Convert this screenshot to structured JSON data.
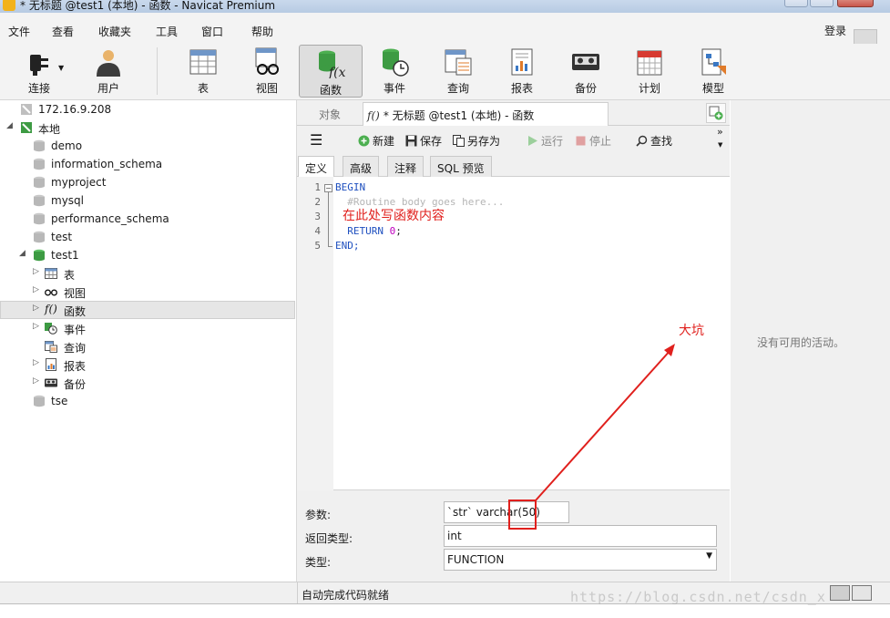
{
  "window": {
    "title": "* 无标题 @test1 (本地) - 函数 - Navicat Premium"
  },
  "menu": {
    "items": [
      "文件",
      "查看",
      "收藏夹",
      "工具",
      "窗口",
      "帮助"
    ],
    "login": "登录"
  },
  "toolbar": {
    "buttons": [
      {
        "label": "连接",
        "icon": "plug-icon"
      },
      {
        "label": "用户",
        "icon": "user-icon"
      },
      {
        "label": "表",
        "icon": "table-icon"
      },
      {
        "label": "视图",
        "icon": "view-glasses-icon"
      },
      {
        "label": "函数",
        "icon": "function-icon",
        "active": true
      },
      {
        "label": "事件",
        "icon": "event-clock-icon"
      },
      {
        "label": "查询",
        "icon": "query-icon"
      },
      {
        "label": "报表",
        "icon": "report-icon"
      },
      {
        "label": "备份",
        "icon": "backup-tape-icon"
      },
      {
        "label": "计划",
        "icon": "calendar-icon"
      },
      {
        "label": "模型",
        "icon": "model-icon"
      }
    ]
  },
  "sidebar": {
    "connection_remote": "172.16.9.208",
    "connection_local": "本地",
    "databases": [
      "demo",
      "information_schema",
      "myproject",
      "mysql",
      "performance_schema",
      "test",
      "test1"
    ],
    "test1_children": [
      "表",
      "视图",
      "函数",
      "事件",
      "查询",
      "报表",
      "备份"
    ],
    "last_db": "tse",
    "selected": "函数"
  },
  "tabs": {
    "objects": "对象",
    "document": "* 无标题 @test1 (本地) - 函数"
  },
  "editor_toolbar": {
    "new": "新建",
    "save": "保存",
    "save_as": "另存为",
    "run": "运行",
    "stop": "停止",
    "find": "查找"
  },
  "subtabs": [
    "定义",
    "高级",
    "注释",
    "SQL 预览"
  ],
  "code": {
    "lines": [
      {
        "n": "1",
        "kind": "kw",
        "text": "BEGIN"
      },
      {
        "n": "2",
        "kind": "cm",
        "text": "  #Routine body goes here..."
      },
      {
        "n": "3",
        "kind": "blank",
        "text": ""
      },
      {
        "n": "4",
        "kind": "return",
        "text_kw": "  RETURN ",
        "text_num": "0",
        "text_end": ";"
      },
      {
        "n": "5",
        "kind": "kw",
        "text": "END;"
      }
    ]
  },
  "annotations": {
    "write_here": "在此处写函数内容",
    "pitfall": "大坑"
  },
  "properties": {
    "params_label": "参数:",
    "params_value": "`str` varchar(50)",
    "return_label": "返回类型:",
    "return_value": "int",
    "type_label": "类型:",
    "type_value": "FUNCTION"
  },
  "right_panel": {
    "empty": "没有可用的活动。"
  },
  "status": {
    "text": "自动完成代码就绪"
  },
  "watermark": "https://blog.csdn.net/csdn_x",
  "colors": {
    "annotation": "#e0201d",
    "keyword": "#1e4fbf",
    "number": "#c000c0"
  }
}
